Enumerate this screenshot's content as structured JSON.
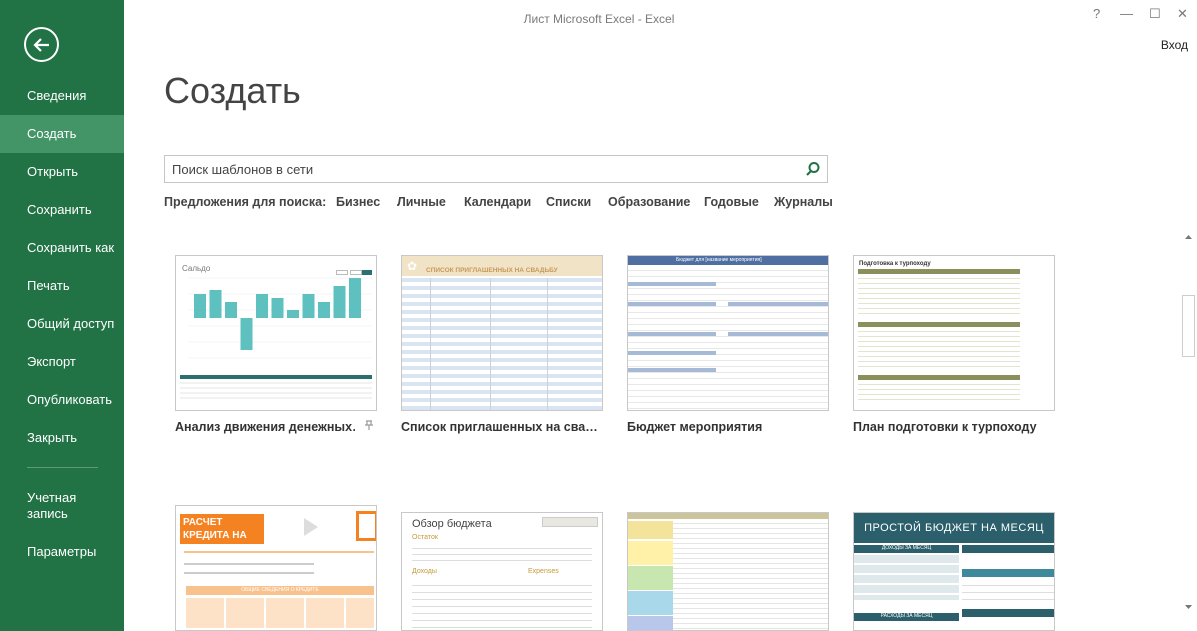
{
  "window": {
    "title": "Лист Microsoft Excel - Excel",
    "help": "?",
    "minimize": "—",
    "maximize": "☐",
    "close": "✕",
    "signin": "Вход"
  },
  "sidebar": {
    "items": [
      {
        "label": "Сведения"
      },
      {
        "label": "Создать",
        "active": true
      },
      {
        "label": "Открыть"
      },
      {
        "label": "Сохранить"
      },
      {
        "label": "Сохранить как"
      },
      {
        "label": "Печать"
      },
      {
        "label": "Общий доступ"
      },
      {
        "label": "Экспорт"
      },
      {
        "label": "Опубликовать"
      },
      {
        "label": "Закрыть"
      }
    ],
    "account_line1": "Учетная",
    "account_line2": "запись",
    "options": "Параметры"
  },
  "main": {
    "title": "Создать",
    "search_placeholder": "Поиск шаблонов в сети",
    "suggestions_label": "Предложения для поиска:",
    "suggestions": [
      "Бизнес",
      "Личные",
      "Календари",
      "Списки",
      "Образование",
      "Годовые",
      "Журналы"
    ]
  },
  "templates": [
    {
      "name": "Анализ движения денежных…",
      "thumb_title": "Сальдо",
      "chart_data": {
        "type": "bar",
        "values": [
          3,
          3.5,
          2,
          -4,
          3,
          2.5,
          1,
          3,
          2,
          4,
          5
        ]
      }
    },
    {
      "name": "Список приглашенных на сва…",
      "thumb_title": "СПИСОК ПРИГЛАШЕННЫХ НА СВАДЬБУ"
    },
    {
      "name": "Бюджет мероприятия",
      "thumb_title": "Бюджет для [название мероприятия]"
    },
    {
      "name": "План подготовки к турпоходу",
      "thumb_title": "Подготовка к турпоходу"
    },
    {
      "name": "",
      "thumb_title": "РАСЧЕТ КРЕДИТА НА ОБУЧЕНИЕ",
      "thumb_section": "ОБЩИЕ СВЕДЕНИЯ О КРЕДИТЕ"
    },
    {
      "name": "",
      "thumb_title": "Обзор бюджета",
      "thumb_sub1": "Остаток",
      "thumb_sub2": "Доходы",
      "thumb_sub3": "Expenses"
    },
    {
      "name": "",
      "thumb_title": ""
    },
    {
      "name": "",
      "thumb_title": "ПРОСТОЙ БЮДЖЕТ НА МЕСЯЦ",
      "thumb_sub1": "ДОХОДЫ ЗА МЕСЯЦ",
      "thumb_sub2": "РАСХОДЫ ЗА МЕСЯЦ"
    }
  ],
  "colors": {
    "sidebar": "#217346",
    "sidebar_active": "#439467"
  }
}
